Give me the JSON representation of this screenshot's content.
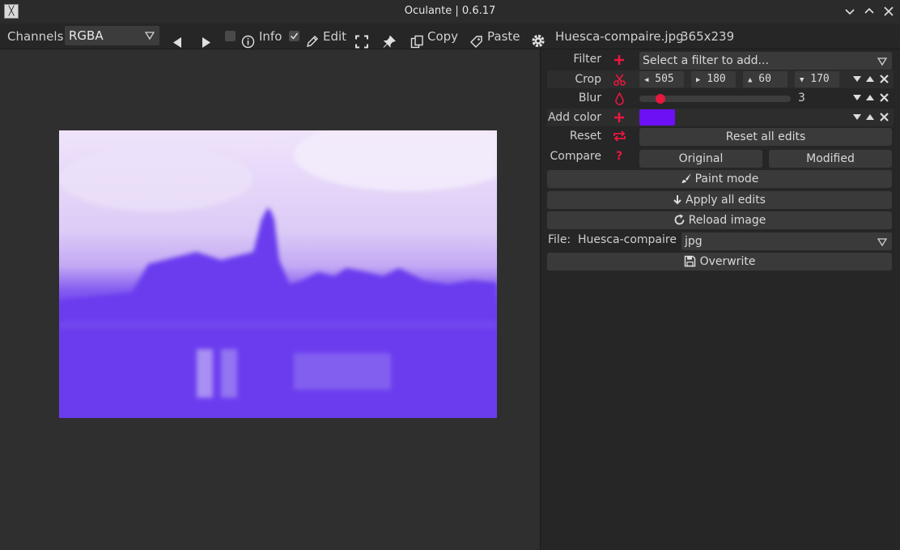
{
  "window": {
    "title": "Oculante | 0.6.17",
    "app_icon_glyph": "╳"
  },
  "toolbar": {
    "channels_label": "Channels",
    "channel_value": "RGBA",
    "info_label": "Info",
    "edit_label": "Edit",
    "copy_label": "Copy",
    "paste_label": "Paste",
    "file_name": "Huesca-compaire.jpg",
    "dimensions": "365x239",
    "info_checked": false,
    "edit_checked": true
  },
  "panel": {
    "filter": {
      "label": "Filter",
      "placeholder": "Select a filter to add..."
    },
    "crop": {
      "label": "Crop",
      "values": [
        "505",
        "180",
        "60",
        "170"
      ]
    },
    "blur": {
      "label": "Blur",
      "value": "3",
      "fraction": 0.14
    },
    "add_color": {
      "label": "Add color",
      "color": "#6d10f6"
    },
    "reset": {
      "label": "Reset",
      "button": "Reset all edits"
    },
    "compare": {
      "label": "Compare",
      "help_glyph": "?",
      "original": "Original",
      "modified": "Modified"
    },
    "paint_mode": "Paint mode",
    "apply_all": "Apply all edits",
    "reload": "Reload image",
    "file": {
      "label": "File:",
      "name": "Huesca-compaire",
      "format": "jpg"
    },
    "overwrite": "Overwrite"
  },
  "colors": {
    "accent": "#e8173f",
    "image_tint": "#6a3cee"
  }
}
